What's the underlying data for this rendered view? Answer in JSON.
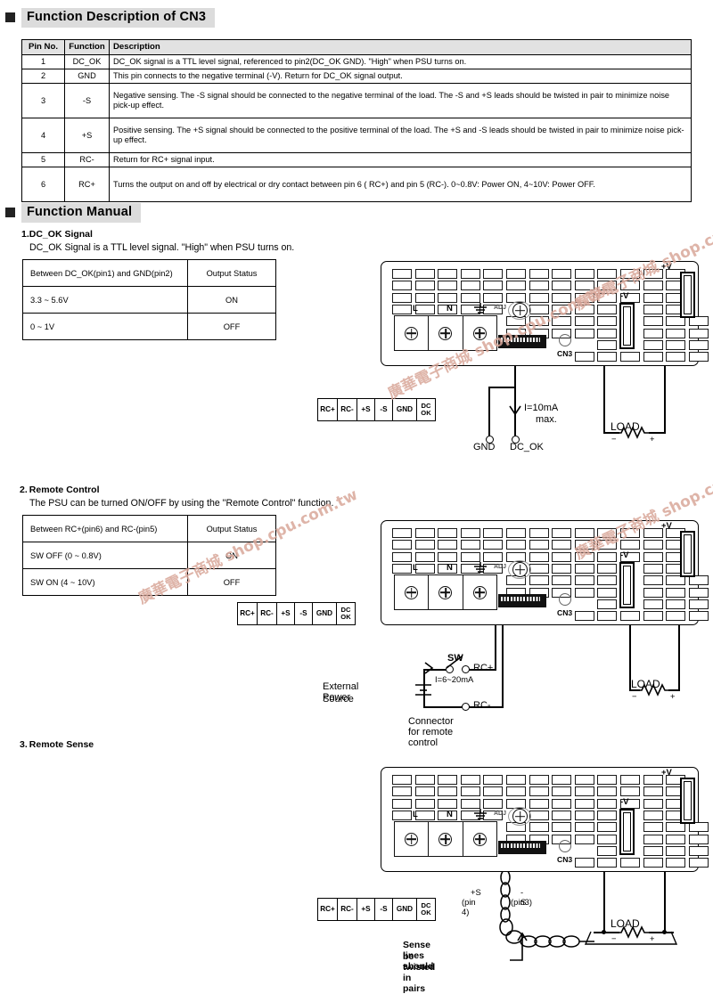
{
  "sections": {
    "cn3": {
      "title": "Function Description of CN3"
    },
    "manual": {
      "title": "Function Manual"
    }
  },
  "cn3_table": {
    "headers": [
      "Pin No.",
      "Function",
      "Description"
    ],
    "rows": [
      {
        "pin": "1",
        "func": "DC_OK",
        "desc": "DC_OK signal is a TTL level signal, referenced to pin2(DC_OK GND). \"High\" when PSU turns on."
      },
      {
        "pin": "2",
        "func": "GND",
        "desc": "This pin connects to the negative terminal (-V). Return for DC_OK signal output."
      },
      {
        "pin": "3",
        "func": "-S",
        "desc": "Negative sensing. The -S signal should be connected to the negative terminal of the load. The -S and +S leads should be twisted in pair to minimize noise pick-up effect."
      },
      {
        "pin": "4",
        "func": "+S",
        "desc": "Positive sensing. The +S signal should be connected to the positive terminal of the load. The +S and -S leads should be twisted in pair to minimize noise pick-up effect."
      },
      {
        "pin": "5",
        "func": "RC-",
        "desc": "Return for RC+ signal input."
      },
      {
        "pin": "6",
        "func": "RC+",
        "desc": "Turns the output on and off by electrical or dry contact between pin 6 ( RC+) and pin 5 (RC-). 0~0.8V: Power ON, 4~10V: Power OFF."
      }
    ]
  },
  "item1": {
    "number": "1.",
    "heading": "DC_OK Signal",
    "note": "DC_OK Signal is a TTL level signal. \"High\" when PSU turns on.",
    "table": {
      "headers": [
        "Between DC_OK(pin1) and GND(pin2)",
        "Output Status"
      ],
      "rows": [
        {
          "cond": "3.3 ~ 5.6V",
          "status": "ON"
        },
        {
          "cond": "0 ~ 1V",
          "status": "OFF"
        }
      ]
    },
    "diagram": {
      "current_label_1": "I=10mA",
      "current_label_2": "max.",
      "terminal_gnd": "GND",
      "terminal_dcok": "DC_OK",
      "load": "LOAD",
      "load_minus": "−",
      "load_plus": "+"
    }
  },
  "item2": {
    "number": "2.",
    "heading": "Remote Control",
    "note": "The PSU can be turned ON/OFF by using the \"Remote Control\" function.",
    "table": {
      "headers": [
        "Between RC+(pin6) and RC-(pin5)",
        "Output Status"
      ],
      "rows": [
        {
          "cond": "SW OFF (0 ~ 0.8V)",
          "status": "ON"
        },
        {
          "cond": "SW ON (4 ~ 10V)",
          "status": "OFF"
        }
      ]
    },
    "diagram": {
      "switch": "SW",
      "rc_plus": "RC+",
      "rc_minus": "RC-",
      "current": "I=6~20mA",
      "source_line1": "External Power",
      "source_line2": "Source",
      "caption": "Connector for remote control",
      "load": "LOAD",
      "load_minus": "−",
      "load_plus": "+"
    }
  },
  "item3": {
    "number": "3.",
    "heading": "Remote Sense",
    "diagram": {
      "sense_plus": "+S",
      "sense_plus_pin": "(pin 4)",
      "sense_minus": "-S",
      "sense_minus_pin": "(pin3)",
      "twist_note_1": "Sense lines should",
      "twist_note_2": "be twisted in pairs",
      "load": "LOAD",
      "load_minus": "−",
      "load_plus": "+"
    }
  },
  "pin_strip": {
    "cells": [
      "RC+",
      "RC-",
      "+S",
      "-S",
      "GND",
      "DC|OK"
    ],
    "dcok_line1": "DC",
    "dcok_line2": "OK"
  },
  "psu_labels": {
    "ac_l": "L",
    "ac_n": "N",
    "ground": "⏚",
    "adj": "ADJ",
    "cn3": "CN3",
    "v_plus": "+V",
    "v_minus": "-V"
  },
  "watermark": {
    "text": "廣華電子商城 shop.cpu.com.tw"
  },
  "colors": {
    "header_bg": "#dcdcdc",
    "table_header_bg": "#e2e2e2",
    "line": "#000000",
    "watermark": "#d9a79a"
  }
}
